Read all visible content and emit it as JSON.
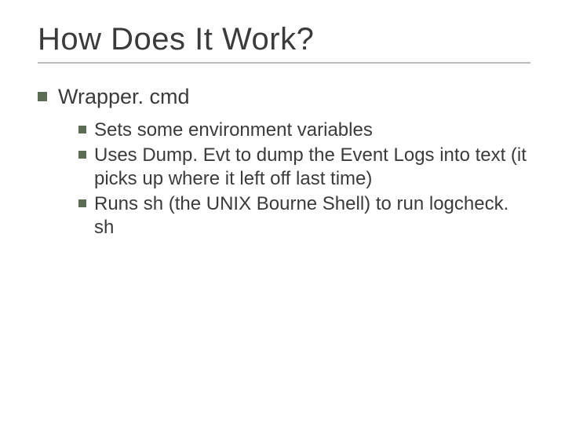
{
  "slide": {
    "title": "How Does It Work?",
    "bullets": [
      {
        "text": "Wrapper. cmd",
        "children": [
          {
            "text": "Sets some environment variables"
          },
          {
            "text": "Uses Dump. Evt to dump the Event Logs into text (it picks up where it left off last time)"
          },
          {
            "text": "Runs sh (the UNIX Bourne Shell) to run logcheck. sh"
          }
        ]
      }
    ]
  }
}
